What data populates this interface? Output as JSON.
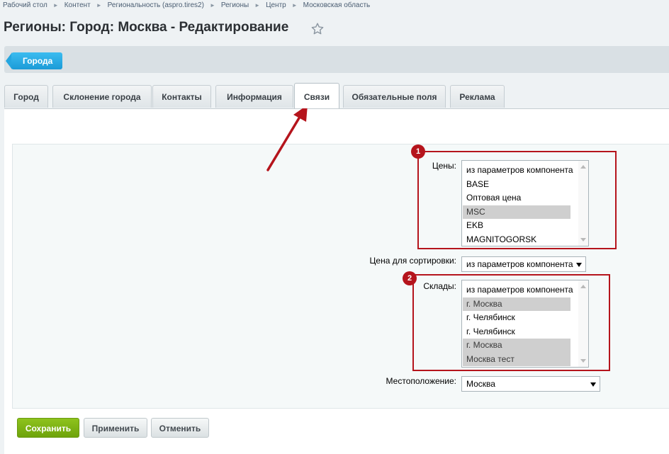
{
  "breadcrumb": [
    "Рабочий стол",
    "Контент",
    "Региональность (aspro.tires2)",
    "Регионы",
    "Центр",
    "Московская область"
  ],
  "page_title": "Регионы: Город: Москва - Редактирование",
  "toolbar": {
    "cities_button": "Города"
  },
  "tabs": [
    {
      "label": "Город"
    },
    {
      "label": "Склонение города"
    },
    {
      "label": "Контакты"
    },
    {
      "label": "Информация"
    },
    {
      "label": "Связи"
    },
    {
      "label": "Обязательные поля"
    },
    {
      "label": "Реклама"
    }
  ],
  "active_tab": "Связи",
  "form": {
    "prices": {
      "label": "Цены:",
      "options": [
        {
          "text": "из параметров компонента",
          "selected": false
        },
        {
          "text": "BASE",
          "selected": false
        },
        {
          "text": "Оптовая цена",
          "selected": false
        },
        {
          "text": "MSC",
          "selected": true
        },
        {
          "text": "EKB",
          "selected": false
        },
        {
          "text": "MAGNITOGORSK",
          "selected": false
        }
      ]
    },
    "sort_price": {
      "label": "Цена для сортировки:",
      "value": "из параметров компонента"
    },
    "warehouses": {
      "label": "Склады:",
      "options": [
        {
          "text": "из параметров компонента",
          "selected": false
        },
        {
          "text": "г. Москва",
          "selected": true
        },
        {
          "text": "г. Челябинск",
          "selected": false
        },
        {
          "text": "г. Челябинск",
          "selected": false
        },
        {
          "text": "г. Москва",
          "selected": true
        },
        {
          "text": "Москва тест",
          "selected": true
        }
      ]
    },
    "location": {
      "label": "Местоположение:",
      "value": "Москва"
    }
  },
  "annotations": {
    "badge1": "1",
    "badge2": "2"
  },
  "buttons": {
    "save": "Сохранить",
    "apply": "Применить",
    "cancel": "Отменить"
  },
  "colors": {
    "annotation": "#b5141c",
    "save_button": "#7bb314",
    "cities_button": "#1b9bd7"
  }
}
